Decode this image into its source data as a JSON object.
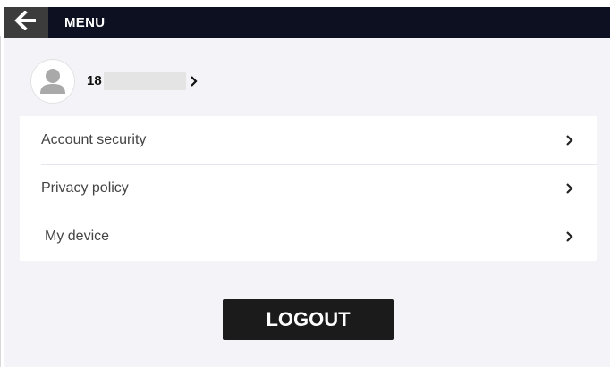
{
  "header": {
    "title": "MENU",
    "back_icon": "arrow-left-icon"
  },
  "profile": {
    "avatar_icon": "user-avatar-icon",
    "phone_prefix": "18",
    "chevron_icon": "chevron-right-icon"
  },
  "menu": {
    "items": [
      {
        "label": "Account security",
        "icon": "chevron-right-icon"
      },
      {
        "label": "Privacy policy",
        "icon": "chevron-right-icon"
      },
      {
        "label": "My device",
        "icon": "chevron-right-icon"
      }
    ]
  },
  "logout": {
    "label": "LOGOUT"
  },
  "colors": {
    "header_bg": "#0d1020",
    "page_bg": "#f4f3f8",
    "button_bg": "#1b1b1b"
  }
}
